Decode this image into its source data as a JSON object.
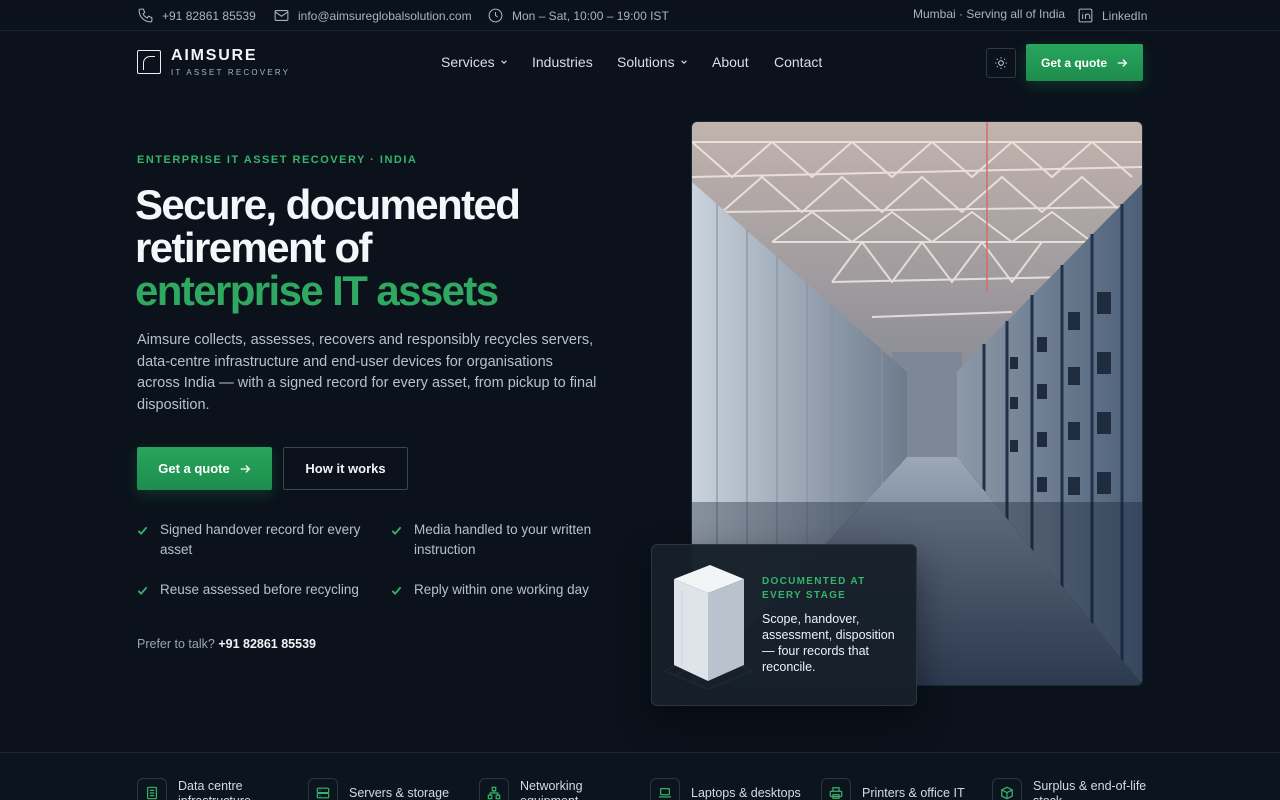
{
  "topbar": {
    "phone": "+91 82861 85539",
    "email": "info@aimsureglobalsolution.com",
    "hours": "Mon – Sat, 10:00 – 19:00 IST",
    "location": "Mumbai · Serving all of India",
    "linkedin": "LinkedIn"
  },
  "brand": {
    "name": "AIMSURE",
    "tagline": "IT ASSET RECOVERY"
  },
  "nav": {
    "items": [
      "Services",
      "Industries",
      "Solutions",
      "About",
      "Contact"
    ],
    "quote_label": "Get a quote"
  },
  "hero": {
    "eyebrow": "ENTERPRISE IT ASSET RECOVERY · INDIA",
    "headline_1": "Secure, documented",
    "headline_2": "retirement of",
    "headline_accent": "enterprise IT assets",
    "lead": "Aimsure collects, assesses, recovers and responsibly recycles servers, data-centre infrastructure and end-user devices for organisations across India — with a signed record for every asset, from pickup to final disposition.",
    "cta_primary": "Get a quote",
    "cta_secondary": "How it works",
    "checks": [
      "Signed handover record for every asset",
      "Media handled to your written instruction",
      "Reuse assessed before recycling",
      "Reply within one working day"
    ],
    "talk_prefix": "Prefer to talk?",
    "talk_phone": "+91 82861 85539"
  },
  "stage_card": {
    "eyebrow": "DOCUMENTED AT EVERY STAGE",
    "text": "Scope, handover, assessment, disposition — four records that reconcile."
  },
  "categories": [
    {
      "label": "Data centre infrastructure",
      "icon": "server-rack-icon"
    },
    {
      "label": "Servers & storage",
      "icon": "storage-icon"
    },
    {
      "label": "Networking equipment",
      "icon": "network-icon"
    },
    {
      "label": "Laptops & desktops",
      "icon": "laptop-icon"
    },
    {
      "label": "Printers & office IT",
      "icon": "printer-icon"
    },
    {
      "label": "Surplus & end-of-life stock",
      "icon": "box-icon"
    }
  ],
  "colors": {
    "background": "#0b121b",
    "accent": "#2fa861",
    "button": "#22985a"
  }
}
